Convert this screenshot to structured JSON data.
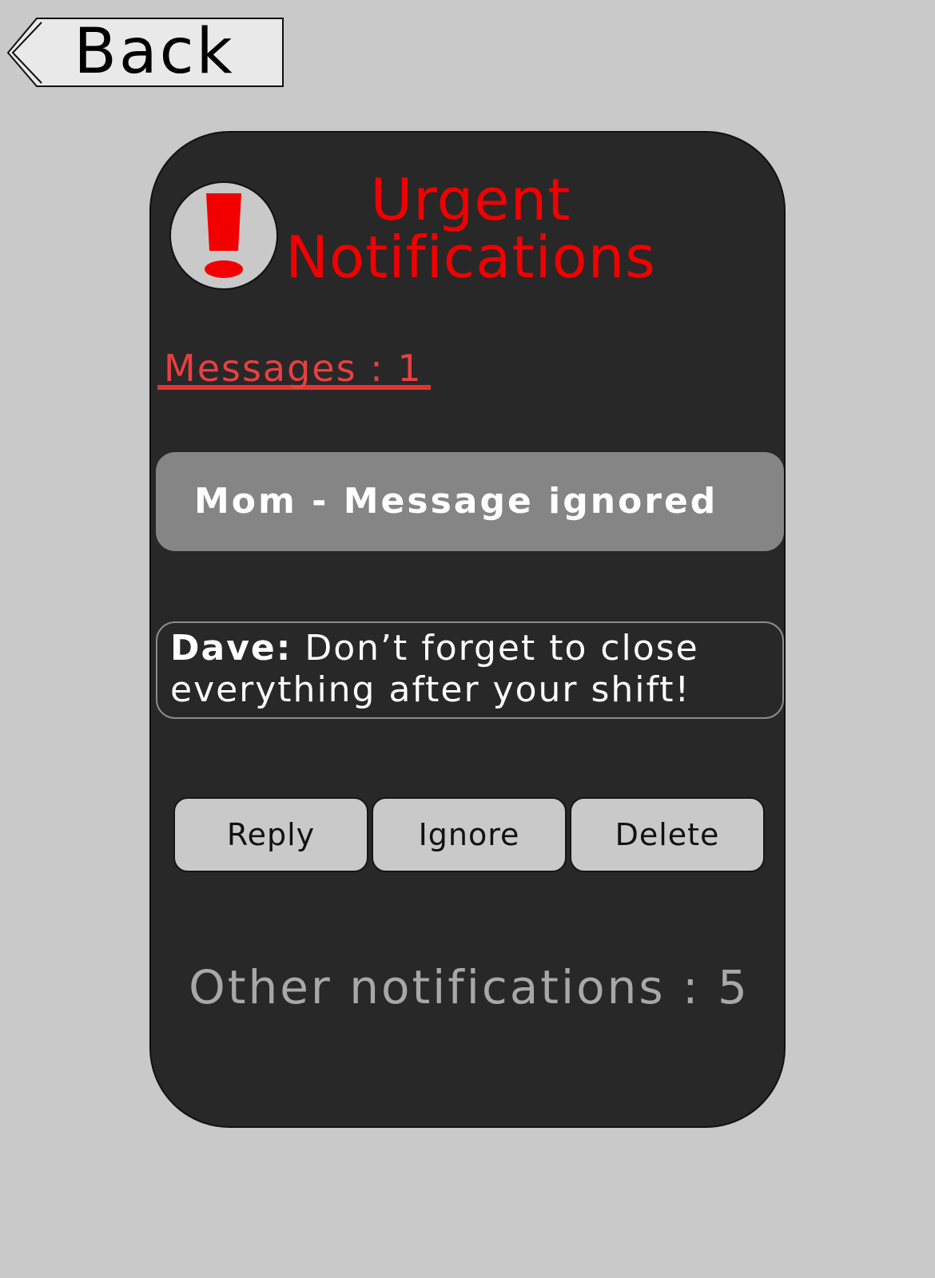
{
  "back_button": {
    "label": "Back",
    "icon": "arrow-left-tab-icon"
  },
  "header": {
    "icon": "exclamation-icon",
    "title_line1": "Urgent",
    "title_line2": "Notifications"
  },
  "messages": {
    "count_label": "Messages : 1"
  },
  "ignored_notice": {
    "text": "Mom - Message ignored"
  },
  "current_message": {
    "sender": "Dave:",
    "line1": " Don’t forget to close",
    "line2": "everything after your shift!"
  },
  "actions": {
    "reply_label": "Reply",
    "ignore_label": "Ignore",
    "delete_label": "Delete"
  },
  "footer": {
    "other_notifications_label": "Other notifications : 5"
  },
  "colors": {
    "background": "#c9c9c9",
    "card": "#282828",
    "accent_red": "#f20000",
    "ignored_card": "#858585",
    "button": "#c9c9c9",
    "muted_text": "#a8a8a8"
  }
}
